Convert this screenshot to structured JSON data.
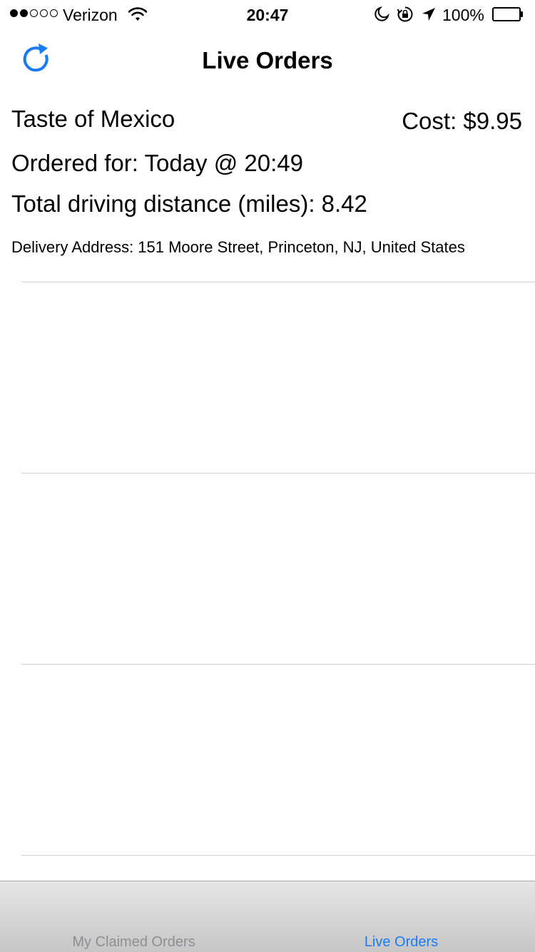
{
  "status_bar": {
    "carrier": "Verizon",
    "signal_filled_dots": 2,
    "signal_total_dots": 5,
    "time": "20:47",
    "battery_percent": "100%",
    "icons": [
      "wifi-icon",
      "moon-icon",
      "rotation-lock-icon",
      "location-arrow-icon",
      "battery-icon"
    ]
  },
  "nav": {
    "title": "Live Orders",
    "refresh_icon": "refresh-icon",
    "accent_color": "#1a7cf4"
  },
  "orders": [
    {
      "restaurant": "Taste of Mexico",
      "cost": "Cost: $9.95",
      "ordered_for": "Ordered for: Today @ 20:49",
      "distance": "Total driving distance (miles): 8.42",
      "address": "Delivery Address: 151 Moore Street, Princeton, NJ, United States"
    }
  ],
  "tab_bar": {
    "tabs": [
      {
        "label": "My Claimed Orders",
        "selected": false
      },
      {
        "label": "Live Orders",
        "selected": true
      }
    ],
    "selected_color": "#1a7cf4",
    "unselected_color": "#8e8e93"
  }
}
